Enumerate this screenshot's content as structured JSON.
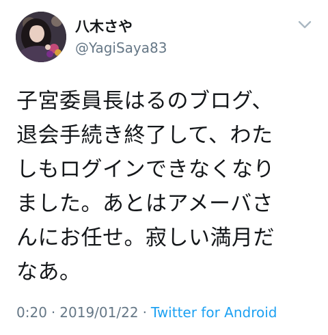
{
  "user": {
    "display_name": "八木さや",
    "handle": "@YagiSaya83",
    "avatar_icon": "profile-photo"
  },
  "menu": {
    "icon": "chevron-down-icon"
  },
  "tweet": {
    "lines": [
      "子宮委員長はるのブログ、",
      "退会手続き終了して、わた",
      "しもログインできなくなり",
      "ました。あとはアメーバさ",
      "んにお任せ。寂しい満月だ",
      "なあ。"
    ]
  },
  "meta": {
    "time": "0:20",
    "separator": "·",
    "date": "2019/01/22",
    "source": "Twitter for Android"
  },
  "colors": {
    "text": "#14171a",
    "secondary": "#657786",
    "link": "#1da1f2",
    "chevron": "#aab8c2"
  }
}
